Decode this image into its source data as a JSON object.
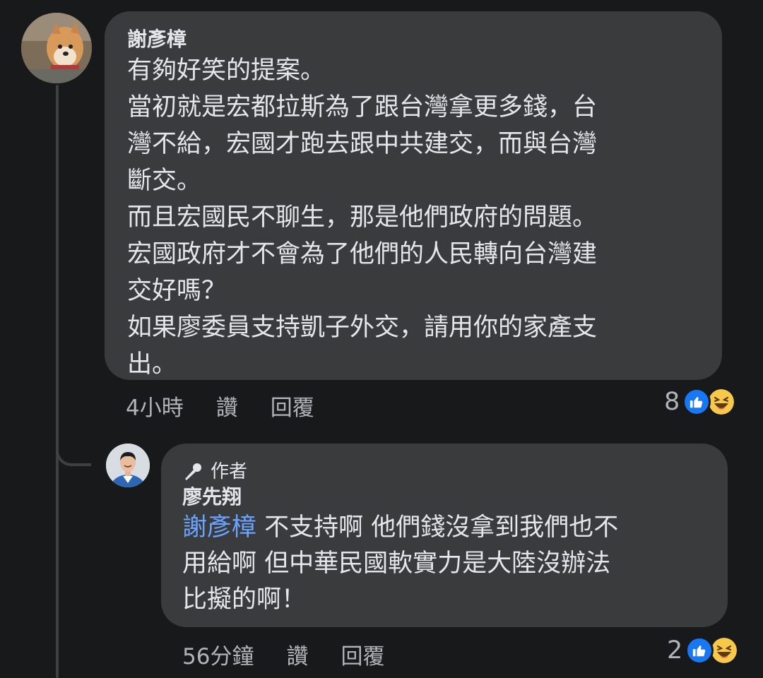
{
  "comment1": {
    "author": "謝彥樟",
    "lines": [
      "有夠好笑的提案。",
      "當初就是宏都拉斯為了跟台灣拿更多錢，台",
      "灣不給，宏國才跑去跟中共建交，而與台灣",
      "斷交。",
      "而且宏國民不聊生，那是他們政府的問題。",
      "宏國政府才不會為了他們的人民轉向台灣建",
      "交好嗎？",
      "如果廖委員支持凱子外交，請用你的家產支",
      "出。"
    ],
    "time": "4小時",
    "like_label": "讚",
    "reply_label": "回覆",
    "reaction_count": "8"
  },
  "reply1": {
    "badge_label": "作者",
    "author": "廖先翔",
    "mention": "謝彥樟",
    "lines": [
      " 不支持啊 他們錢沒拿到我們也不",
      "用給啊 但中華民國軟實力是大陸沒辦法",
      "比擬的啊！"
    ],
    "time": "56分鐘",
    "like_label": "讚",
    "reply_label": "回覆",
    "reaction_count": "2"
  },
  "icons": {
    "like": "like-reaction-icon",
    "haha": "haha-reaction-icon",
    "author_badge": "microphone-icon"
  },
  "colors": {
    "background": "#18191a",
    "bubble": "#3a3b3c",
    "text": "#e4e6eb",
    "secondary": "#b0b3b8",
    "mention": "#6aa3ff",
    "like_blue": "#1877f2"
  }
}
